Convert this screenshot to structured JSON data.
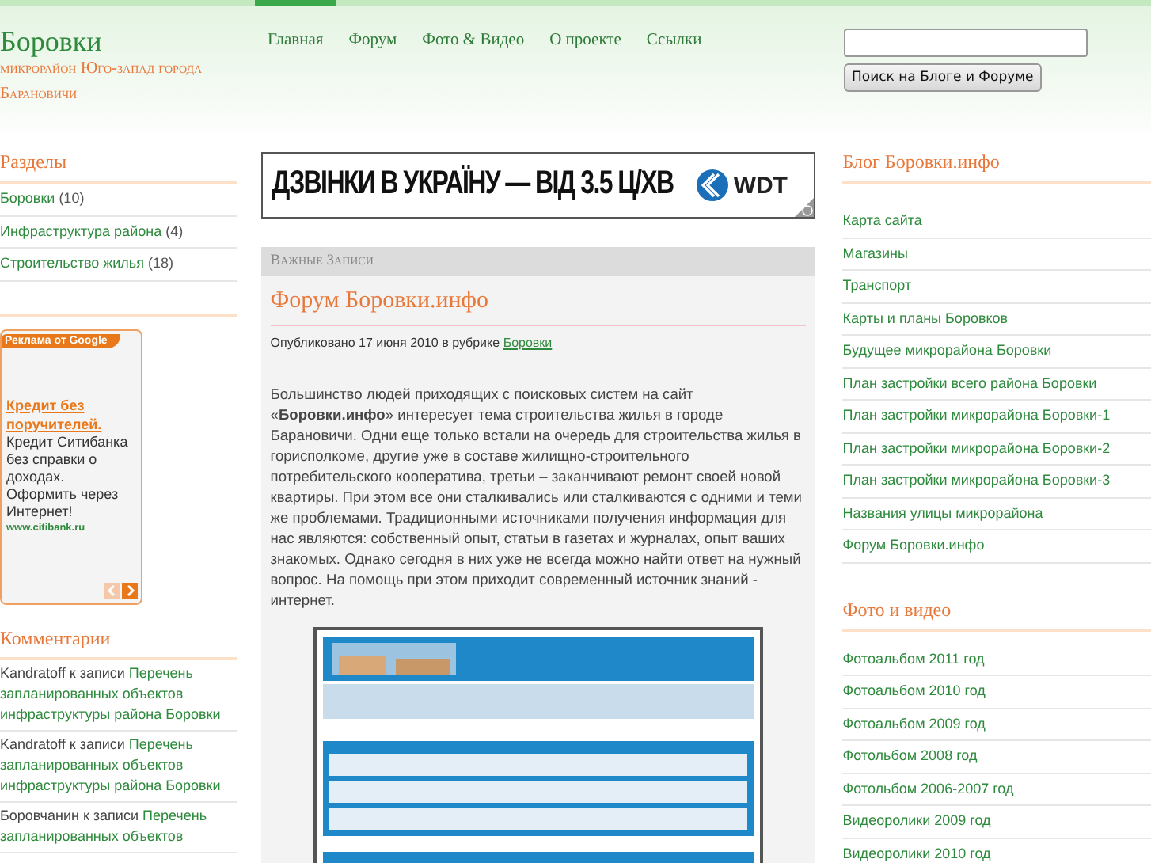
{
  "site": {
    "title": "Боровки",
    "subtitle": "микрорайон Юго-запад города Барановичи"
  },
  "nav": [
    {
      "label": "Главная",
      "selected": true
    },
    {
      "label": "Форум",
      "selected": false
    },
    {
      "label": "Фото & Видео",
      "selected": false
    },
    {
      "label": "О проекте",
      "selected": false
    },
    {
      "label": "Ссылки",
      "selected": false
    }
  ],
  "search": {
    "button": "Поиск на Блоге и Форуме"
  },
  "sections": {
    "title": "Разделы",
    "items": [
      {
        "label": "Боровки",
        "count": "(10)"
      },
      {
        "label": "Инфраструктура района",
        "count": "(4)"
      },
      {
        "label": "Строительство жилья",
        "count": "(18)"
      }
    ]
  },
  "google_ad": {
    "badge": "Реклама от Google",
    "headline": "Кредит без поручителей.",
    "body": "Кредит Ситибанка без справки о доходах. Оформить через Интернет!",
    "url": "www.citibank.ru"
  },
  "comments": {
    "title": "Комментарии",
    "items": [
      {
        "author": "Kandratoff",
        "joiner": "к записи",
        "post": "Перечень запланированных объектов инфраструктуры района Боровки"
      },
      {
        "author": "Kandratoff",
        "joiner": "к записи",
        "post": "Перечень запланированных объектов инфраструктуры района Боровки"
      },
      {
        "author": "Боровчанин",
        "joiner": "к записи",
        "post": "Перечень запланированных объектов"
      }
    ]
  },
  "banner": {
    "text": "ДЗВІНКИ В УКРАЇНУ — ВІД 3.5 Ц/ХВ",
    "logo": "WDT"
  },
  "featured": {
    "heading": "Важные Записи",
    "post_title": "Форум Боровки.инфо",
    "meta": "Опубликовано 17 июня 2010 в рубрике",
    "category": "Боровки",
    "body": "Большинство людей приходящих с поисковых систем на сайт «**Боровки.инфо**» интересует тема строительства жилья в городе Барановичи. Одни еще только встали на очередь для строительства жилья в горисполкоме, другие уже в составе жилищно-строительного потребительского кооператива, третьи – заканчивают ремонт своей новой квартиры. При этом все они сталкивались или сталкиваются с одними и теми же проблемами. Традиционными источниками получения информация для нас являются: собственный опыт, статьи в газетах и журналах, опыт ваших знакомых. Однако сегодня в них уже не всегда можно найти ответ на нужный вопрос. На помощь при этом приходит современный источник знаний - интернет."
  },
  "blog": {
    "title": "Блог Боровки.инфо",
    "items": [
      "Карта сайта",
      "Магазины",
      "Транспорт",
      "Карты и планы Боровков",
      "Будущее микрорайона Боровки",
      "План застройки всего района Боровки",
      "План застройки микрорайона Боровки-1",
      "План застройки микрорайона Боровки-2",
      "План застройки микрорайона Боровки-3",
      "Названия улицы микрорайона",
      "Форум Боровки.инфо"
    ]
  },
  "media": {
    "title": "Фото и видео",
    "items": [
      "Фотоальбом 2011 год",
      "Фотоальбом 2010 год",
      "Фотоальбом 2009 год",
      "Фотольбом 2008 год",
      "Фотольбом 2006-2007 год",
      "Видеоролики 2009 год",
      "Видеоролики 2010 год"
    ]
  }
}
